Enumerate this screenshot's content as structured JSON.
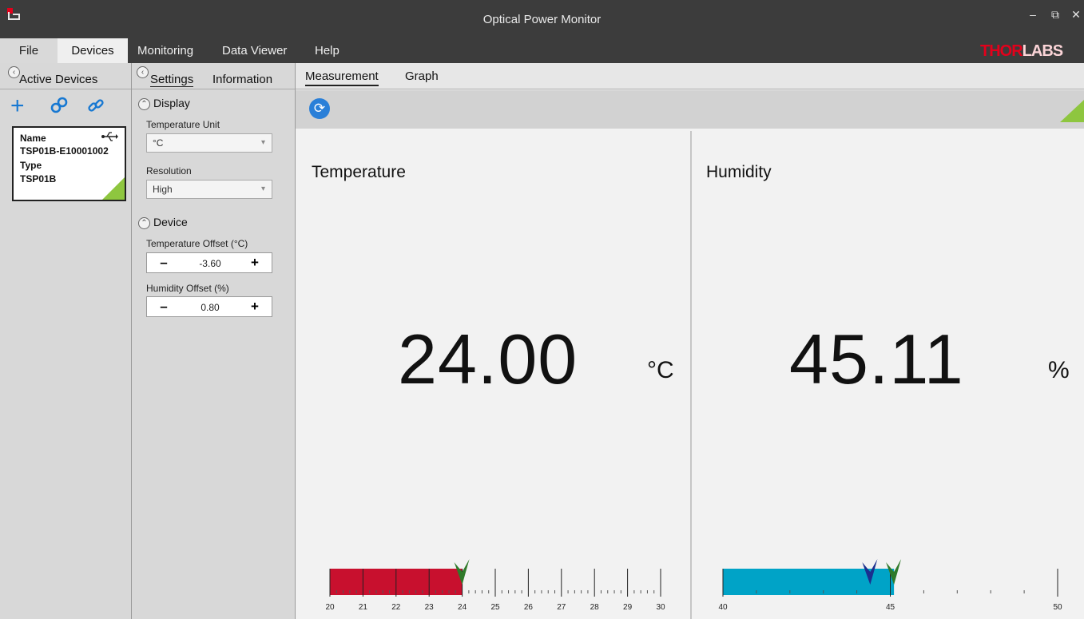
{
  "window": {
    "title": "Optical Power Monitor",
    "controls": [
      "minimize-icon",
      "restore-icon",
      "close-icon"
    ]
  },
  "menu": {
    "items": [
      "File",
      "Devices",
      "Monitoring",
      "Data Viewer",
      "Help"
    ],
    "logo_part_a": "THOR",
    "logo_part_b": "LABS"
  },
  "devices_panel": {
    "title": "Active Devices",
    "tools": [
      "add-icon",
      "connect-icon",
      "link-icon"
    ],
    "device": {
      "name_label": "Name",
      "name": "TSP01B-E10001002",
      "type_label": "Type",
      "type": "TSP01B",
      "connection_icon": "usb-icon"
    }
  },
  "settings_panel": {
    "tabs": [
      "Settings",
      "Information"
    ],
    "display_section": "Display",
    "temperature_unit_label": "Temperature Unit",
    "temperature_unit": "°C",
    "resolution_label": "Resolution",
    "resolution": "High",
    "device_section": "Device",
    "temperature_offset_label": "Temperature Offset (°C)",
    "temperature_offset": "-3.60",
    "humidity_offset_label": "Humidity Offset (%)",
    "humidity_offset": "0.80"
  },
  "main": {
    "tabs": [
      "Measurement",
      "Graph"
    ],
    "accent": "#8ec63f",
    "temperature": {
      "title": "Temperature",
      "value": "24.00",
      "unit": "°C",
      "bar_color": "#c8102e",
      "scale_min": 20,
      "scale_max": 30,
      "current": 24.0,
      "marker_green": 24.0,
      "tick_labels": [
        "20",
        "21",
        "22",
        "23",
        "24",
        "25",
        "26",
        "27",
        "28",
        "29",
        "30"
      ]
    },
    "humidity": {
      "title": "Humidity",
      "value": "45.11",
      "unit": "%",
      "bar_color": "#00a3c7",
      "scale_min": 40,
      "scale_max": 50,
      "current": 45.11,
      "marker_blue": 44.4,
      "marker_green": 45.11,
      "tick_labels": [
        "40",
        "45",
        "50"
      ]
    }
  }
}
